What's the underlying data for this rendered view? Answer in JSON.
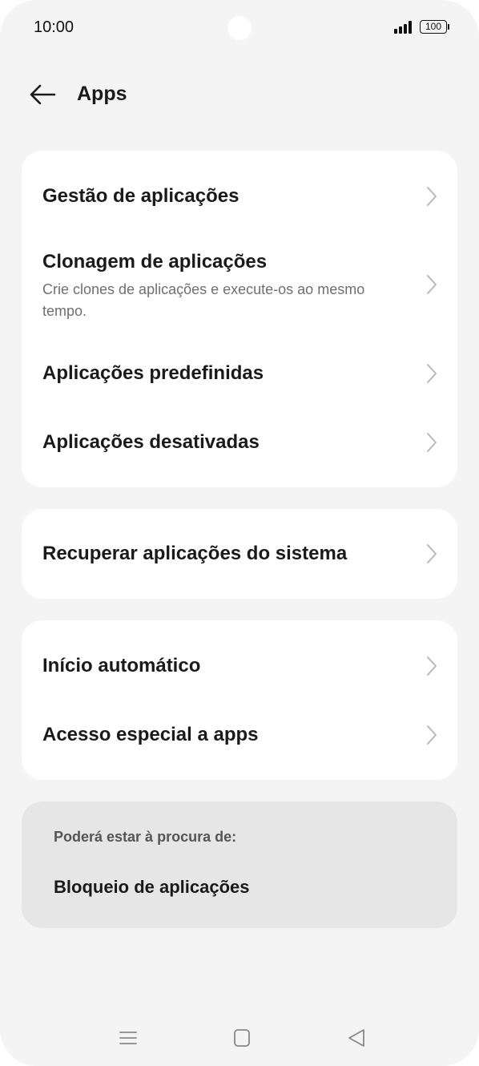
{
  "status_bar": {
    "time": "10:00",
    "battery": "100",
    "icons": [
      "signal-icon",
      "battery-icon"
    ]
  },
  "header": {
    "title": "Apps",
    "back_icon": "arrow-left-icon"
  },
  "groups": [
    {
      "items": [
        {
          "title": "Gestão de aplicações",
          "subtitle": ""
        },
        {
          "title": "Clonagem de aplicações",
          "subtitle": "Crie clones de aplicações e execute-os ao mesmo tempo."
        },
        {
          "title": "Aplicações predefinidas",
          "subtitle": ""
        },
        {
          "title": "Aplicações desativadas",
          "subtitle": ""
        }
      ]
    },
    {
      "items": [
        {
          "title": "Recuperar aplicações do sistema",
          "subtitle": ""
        }
      ]
    },
    {
      "items": [
        {
          "title": "Início automático",
          "subtitle": ""
        },
        {
          "title": "Acesso especial a apps",
          "subtitle": ""
        }
      ]
    }
  ],
  "suggestions": {
    "heading": "Poderá estar à procura de:",
    "items": [
      "Bloqueio de aplicações"
    ]
  },
  "nav_bar": {
    "icons": [
      "menu-icon",
      "home-icon",
      "back-triangle-icon"
    ]
  },
  "colors": {
    "background": "#f4f4f4",
    "card": "#ffffff",
    "suggestion_card": "#e6e6e6",
    "chevron": "#b5b5b5",
    "text_primary": "#1a1a1a",
    "text_secondary": "#6f6f6f"
  }
}
